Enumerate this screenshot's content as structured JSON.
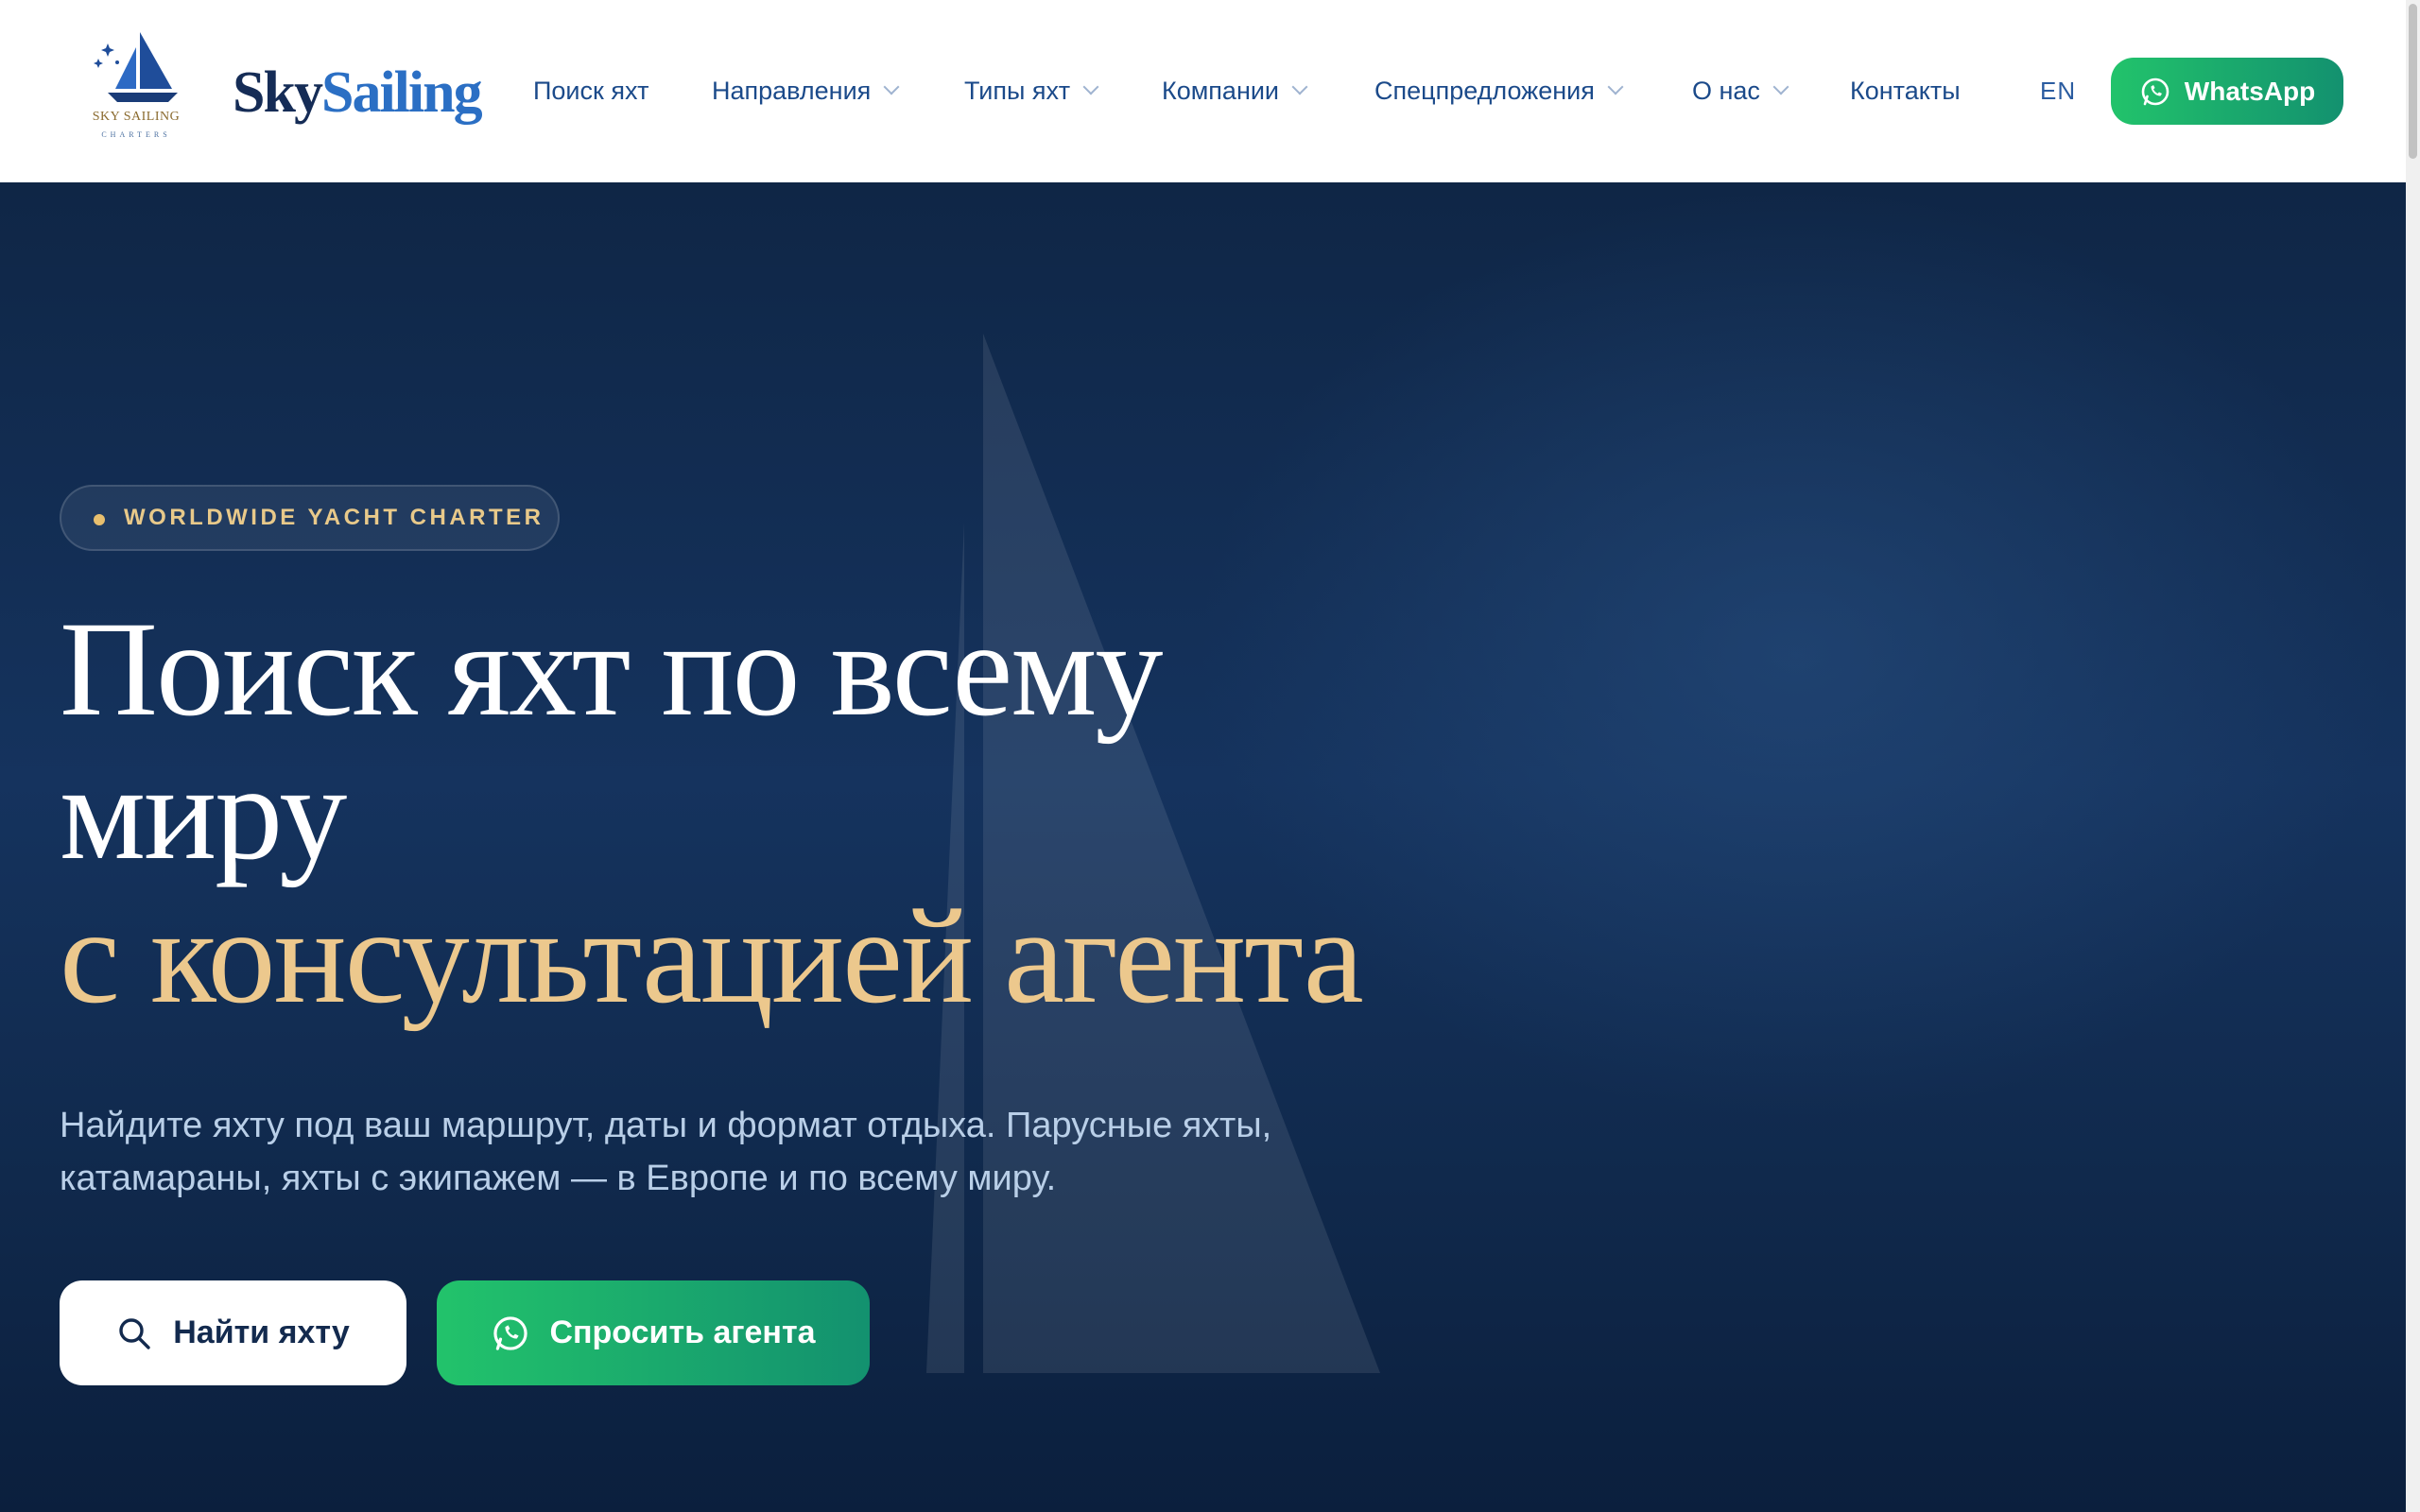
{
  "header": {
    "logo": {
      "line1": "SKY SAILING",
      "line2": "CHARTERS"
    },
    "brand": {
      "part1": "Sky",
      "part2": "Sailing"
    },
    "nav": [
      {
        "label": "Поиск яхт",
        "has_dropdown": false
      },
      {
        "label": "Направления",
        "has_dropdown": true
      },
      {
        "label": "Типы яхт",
        "has_dropdown": true
      },
      {
        "label": "Компании",
        "has_dropdown": true
      },
      {
        "label": "Спецпредложения",
        "has_dropdown": true
      },
      {
        "label": "О нас",
        "has_dropdown": true
      },
      {
        "label": "Контакты",
        "has_dropdown": false
      }
    ],
    "language": "EN",
    "whatsapp_label": "WhatsApp"
  },
  "hero": {
    "badge": "WORLDWIDE YACHT CHARTER",
    "title_line1": "Поиск яхт по всему",
    "title_line2": "миру",
    "title_line3": "с консультацией агента",
    "lead": "Найдите яхту под ваш маршрут, даты и формат отдыха. Парусные яхты, катамараны, яхты с экипажем — в Европе и по всему миру.",
    "find_button": "Найти яхту",
    "agent_button": "Спросить агента"
  },
  "colors": {
    "navy": "#152c56",
    "link_blue": "#1b4a8a",
    "accent_gold": "#ecc88d",
    "whatsapp_green": "#22c36b"
  },
  "icons": [
    "sailboat-logo-icon",
    "chevron-down-icon",
    "whatsapp-icon",
    "search-icon"
  ]
}
